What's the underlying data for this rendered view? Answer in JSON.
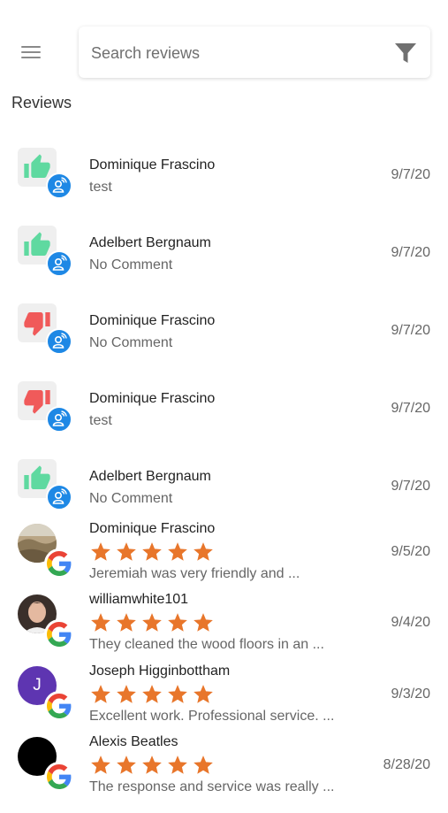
{
  "search": {
    "placeholder": "Search reviews"
  },
  "section_title": "Reviews",
  "colors": {
    "thumb_up": "#5fd9a0",
    "thumb_down": "#f05a5a",
    "kiosk_badge": "#1e88e5",
    "star": "#e8762b",
    "initial_avatar": "#5e35b1"
  },
  "reviews": [
    {
      "source": "kiosk",
      "sentiment": "thumb-up",
      "name": "Dominique Frascino",
      "comment": "test",
      "date": "9/7/20"
    },
    {
      "source": "kiosk",
      "sentiment": "thumb-up",
      "name": "Adelbert Bergnaum",
      "comment": "No Comment",
      "date": "9/7/20"
    },
    {
      "source": "kiosk",
      "sentiment": "thumb-down",
      "name": "Dominique Frascino",
      "comment": "No Comment",
      "date": "9/7/20"
    },
    {
      "source": "kiosk",
      "sentiment": "thumb-down",
      "name": "Dominique Frascino",
      "comment": "test",
      "date": "9/7/20"
    },
    {
      "source": "kiosk",
      "sentiment": "thumb-up",
      "name": "Adelbert Bergnaum",
      "comment": "No Comment",
      "date": "9/7/20"
    },
    {
      "source": "google",
      "avatar": "photo-landscape",
      "rating": 5,
      "name": "Dominique Frascino",
      "comment": "Jeremiah was very friendly and ...",
      "date": "9/5/20"
    },
    {
      "source": "google",
      "avatar": "photo-person",
      "rating": 5,
      "name": "williamwhite101",
      "comment": "They cleaned the wood floors in an ...",
      "date": "9/4/20"
    },
    {
      "source": "google",
      "avatar": "initial",
      "initial": "J",
      "rating": 5,
      "name": "Joseph Higginbottham",
      "comment": "Excellent work. Professional service. ...",
      "date": "9/3/20"
    },
    {
      "source": "google",
      "avatar": "black-circle",
      "rating": 5,
      "name": "Alexis Beatles",
      "comment": "The response and service was really ...",
      "date": "8/28/20"
    }
  ]
}
